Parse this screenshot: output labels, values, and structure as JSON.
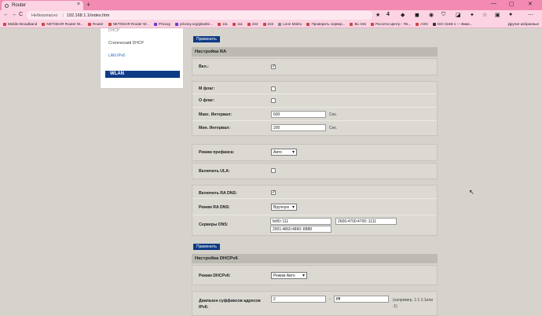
{
  "browser": {
    "tab_title": "Router",
    "tab_close": "×",
    "new_tab": "+",
    "win_min": "—",
    "win_max": "▢",
    "win_close": "✕",
    "nav_back": "←",
    "nav_forward": "→",
    "nav_reload": "C",
    "insecure_label": "Небезопасно",
    "url": "192.168.1.1/index.htm",
    "bookmarks": [
      "Mobile Broadband",
      "NETGEAR Router W...",
      "Router",
      "NETGEAR Router W...",
      "Privoxy",
      "privoxy.org/gitweb/...",
      "111",
      "111",
      "222",
      "222",
      "Leon Mokru",
      "Проверить сервер...",
      "BL-mts",
      "Россети Центр - Пе...",
      "ASN",
      "ISO 3166-1 — Вики..."
    ],
    "other_bookmarks": "Другие избранные",
    "ext_counter": "4",
    "colors": {
      "tabbar": "#f28ab1",
      "toolbar": "#fbd3e2",
      "accent": "#0e3b86"
    }
  },
  "sidebar": {
    "items": [
      {
        "label": "DHCP"
      },
      {
        "label": "Статический DHCP"
      },
      {
        "label": "LAN IPv6"
      }
    ],
    "section": "WLAN"
  },
  "main": {
    "apply_label": "Применить",
    "ra_header": "Настройка RA",
    "enabled_label": "Вкл.:",
    "m_flag_label": "M флаг:",
    "o_flag_label": "O флаг:",
    "max_interval_label": "Макс. Интервал:",
    "max_interval_value": "600",
    "min_interval_label": "Мин. Интервал:",
    "min_interval_value": "200",
    "sec_unit": "Сек.",
    "prefix_mode_label": "Режим префикса:",
    "prefix_mode_value": "Авто",
    "ula_label": "Включить ULA:",
    "ra_dns_label": "Включить RA DNS:",
    "ra_dns_mode_label": "Режим RA DNS:",
    "ra_dns_mode_value": "Вручную",
    "dns_servers_label": "Серверы DNS:",
    "dns1": "fe80::111",
    "dns2": "2606:4700:4700::1111",
    "dns3": "2001:4860:4860::8888",
    "apply2_label": "Применить",
    "dhcp_header": "Настройка DHCPv6",
    "dhcp_mode_label": "Режим DHCPv6:",
    "dhcp_mode_value": "Режим Авто",
    "suffix_label": "Диапазон суффиксов адресов IPv6:",
    "suffix_start": "2",
    "suffix_dash": "-",
    "suffix_end": "ffff",
    "suffix_hint": "(например, 1:1:1:1или :1)"
  }
}
